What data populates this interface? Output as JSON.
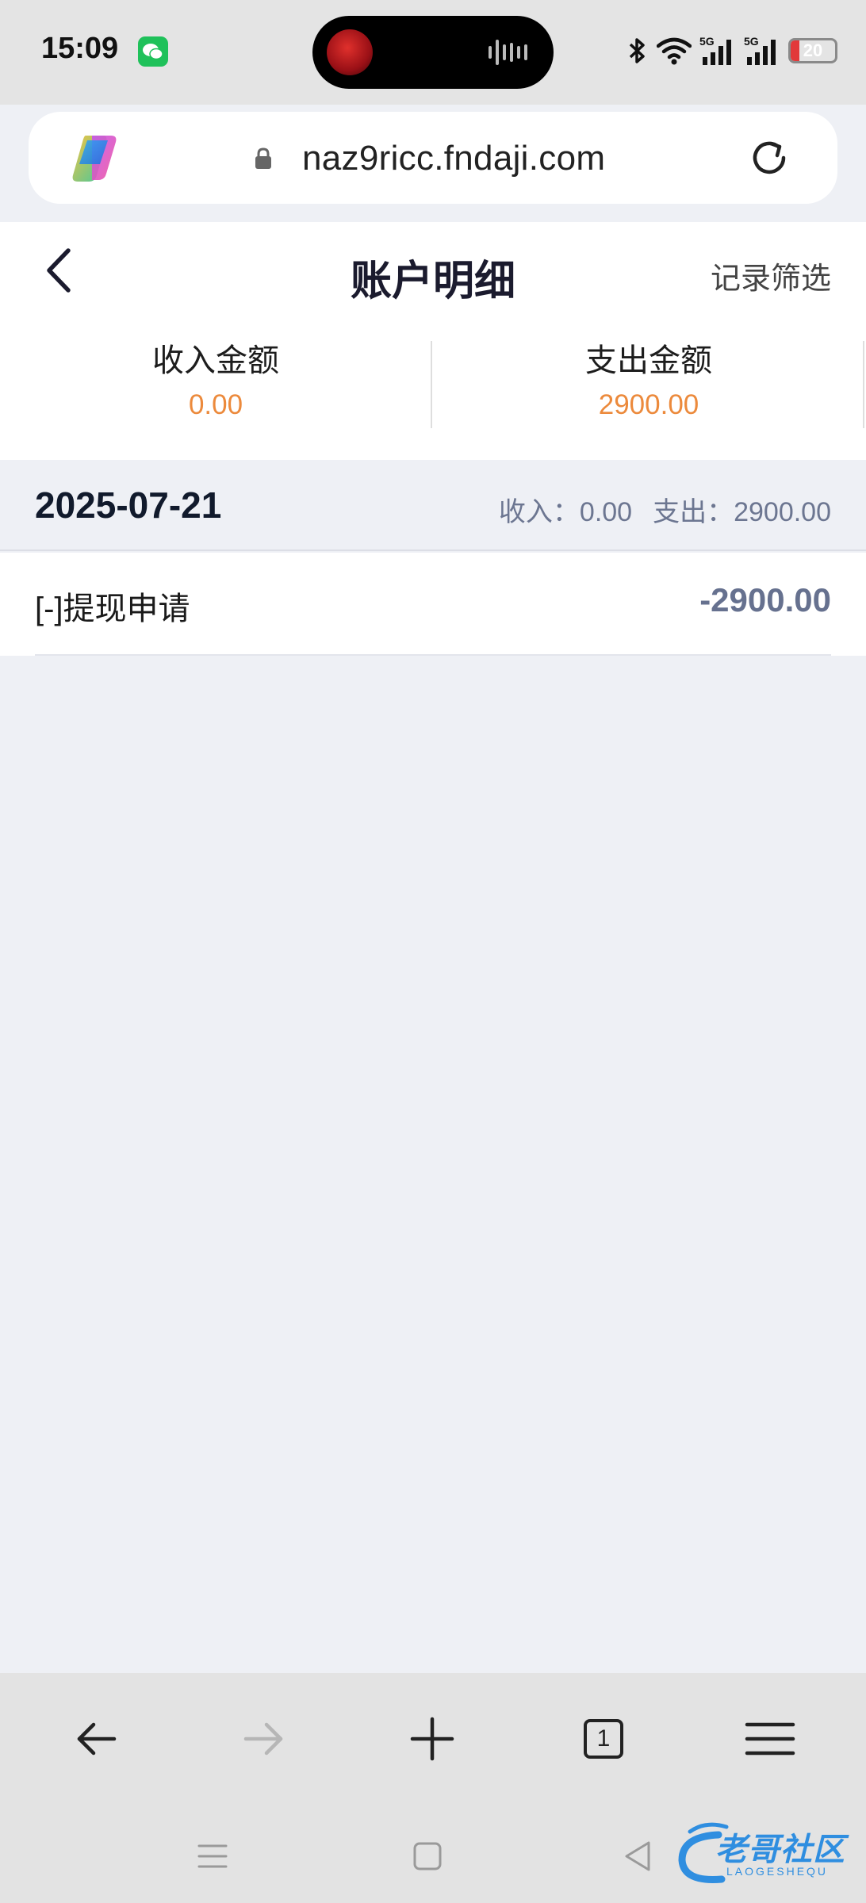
{
  "status_bar": {
    "time": "15:09",
    "network": "5G",
    "network2": "5G",
    "battery": "20",
    "battery_level_percent": 20
  },
  "browser": {
    "url": "naz9ricc.fndaji.com",
    "tab_count": "1"
  },
  "header": {
    "title": "账户明细",
    "filter_label": "记录筛选"
  },
  "summary": {
    "income_label": "收入金额",
    "income_value": "0.00",
    "expense_label": "支出金额",
    "expense_value": "2900.00"
  },
  "groups": [
    {
      "date": "2025-07-21",
      "income_text": "收入：0.00",
      "expense_text": "支出：2900.00",
      "records": [
        {
          "title": "[-]提现申请",
          "amount": "-2900.00"
        }
      ]
    }
  ],
  "watermark": {
    "text": "老哥社区",
    "subtext": "LAOGESHEQU"
  },
  "colors": {
    "accent_orange": "#ec8a3c",
    "amount_gray_blue": "#66718f",
    "page_background": "#eef0f5",
    "chrome_gray": "#e3e3e3"
  }
}
